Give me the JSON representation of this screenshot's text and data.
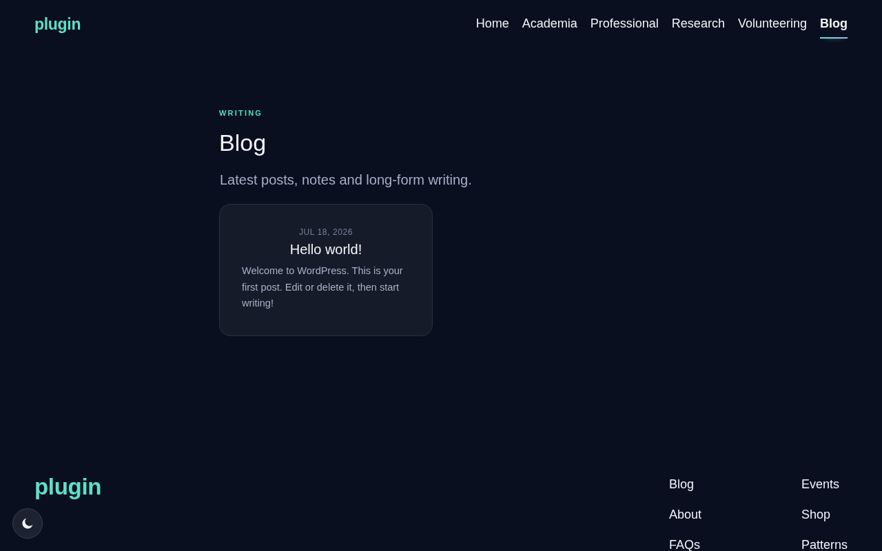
{
  "header": {
    "logo": "plugin",
    "nav": [
      {
        "label": "Home",
        "selected": false
      },
      {
        "label": "Academia",
        "selected": false
      },
      {
        "label": "Professional",
        "selected": false
      },
      {
        "label": "Research",
        "selected": false
      },
      {
        "label": "Volunteering",
        "selected": false
      },
      {
        "label": "Blog",
        "selected": true
      }
    ]
  },
  "page": {
    "eyebrow": "WRITING",
    "title": "Blog",
    "subtitle": "Latest posts, notes and long-form writing."
  },
  "posts": [
    {
      "date": "JUL 18, 2026",
      "title": "Hello world!",
      "excerpt": "Welcome to WordPress. This is your first post. Edit or delete it, then start writing!"
    }
  ],
  "footer": {
    "logo": "plugin",
    "columns": [
      {
        "links": [
          "Blog",
          "About",
          "FAQs"
        ]
      },
      {
        "links": [
          "Events",
          "Shop",
          "Patterns"
        ]
      }
    ]
  }
}
